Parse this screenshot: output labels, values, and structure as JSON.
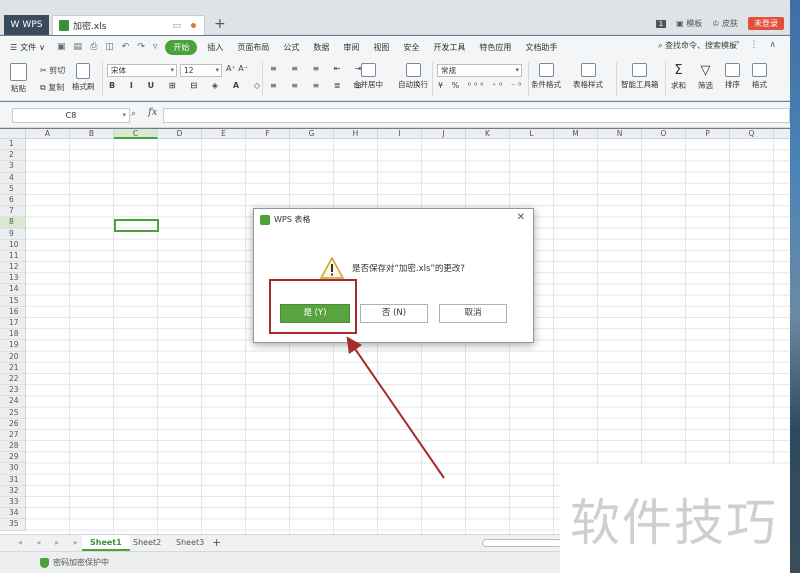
{
  "titlebar": {
    "app_tab": "WPS",
    "doc_tab": "加密.xls",
    "new_tab": "+",
    "page_num": "1",
    "template_label": "模板",
    "skin_label": "皮肤",
    "login_label": "未登录"
  },
  "menubar": {
    "file": "文件",
    "items": [
      "开始",
      "插入",
      "页面布局",
      "公式",
      "数据",
      "审阅",
      "视图",
      "安全",
      "开发工具",
      "特色应用",
      "文档助手"
    ],
    "search": "查找命令、搜索模板"
  },
  "ribbon": {
    "paste": "粘贴",
    "cut": "剪切",
    "copy": "复制",
    "format_painter": "格式刷",
    "font_name": "宋体",
    "font_size": "12",
    "merge_center": "合并居中",
    "wrap_text": "自动换行",
    "number_format": "常规",
    "conditional_format": "条件格式",
    "table_style": "表格样式",
    "smart_toolbox": "智能工具箱",
    "sum": "求和",
    "filter": "筛选",
    "sort": "排序",
    "format": "格式"
  },
  "formulabar": {
    "cell_ref": "C8",
    "fx": "fx"
  },
  "grid": {
    "columns": [
      "A",
      "B",
      "C",
      "D",
      "E",
      "F",
      "G",
      "H",
      "I",
      "J",
      "K",
      "L",
      "M",
      "N",
      "O",
      "P",
      "Q"
    ],
    "rows": [
      "1",
      "2",
      "3",
      "4",
      "5",
      "6",
      "7",
      "8",
      "9",
      "10",
      "11",
      "12",
      "13",
      "14",
      "15",
      "16",
      "17",
      "18",
      "19",
      "20",
      "21",
      "22",
      "23",
      "24",
      "25",
      "26",
      "27",
      "28",
      "29",
      "30",
      "31",
      "32",
      "33",
      "34",
      "35"
    ],
    "active_column": "C",
    "active_row": "8"
  },
  "sheets": [
    "Sheet1",
    "Sheet2",
    "Sheet3"
  ],
  "active_sheet": "Sheet1",
  "status": {
    "text": "密码加密保护中"
  },
  "dialog": {
    "title": "WPS 表格",
    "message": "是否保存对“加密.xls”的更改?",
    "yes": "是 (Y)",
    "no": "否 (N)",
    "cancel": "取消"
  },
  "watermark": "软件技巧",
  "colors": {
    "accent": "#4ba13a",
    "annotation": "#a72c2c"
  }
}
